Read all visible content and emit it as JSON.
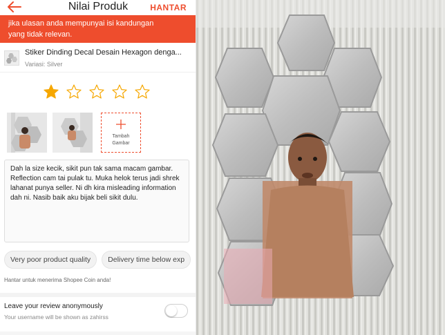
{
  "header": {
    "title": "Nilai Produk",
    "submit_label": "HANTAR",
    "back_icon": "arrow-left-icon",
    "accent": "#ee4d2d"
  },
  "banner": {
    "line1": "jika ulasan anda mempunyai isi kandungan",
    "line2": "yang tidak relevan."
  },
  "product": {
    "name": "Stiker Dinding Decal Desain Hexagon denga...",
    "variation": "Variasi: Silver"
  },
  "rating": {
    "value": 1,
    "max": 5,
    "filled_color": "#f6a700"
  },
  "add_photo": {
    "label_line1": "Tambah",
    "label_line2": "Gambar",
    "icon": "plus-icon"
  },
  "review_text": "Dah la size kecik, sikit pun tak sama macam gambar. Reflection cam tai pulak tu. Muka helok terus jadi shrek lahanat punya seller. Ni dh kira misleading information dah ni. Nasib baik aku bijak beli sikit dulu.",
  "tags": [
    "Very poor product quality",
    "Delivery time below exp"
  ],
  "coin_note": "Hantar untuk menerima Shopee Coin anda!",
  "anonymous": {
    "title": "Leave your review anonymously",
    "subtitle": "Your username will be shown as zahirss",
    "enabled": false
  }
}
